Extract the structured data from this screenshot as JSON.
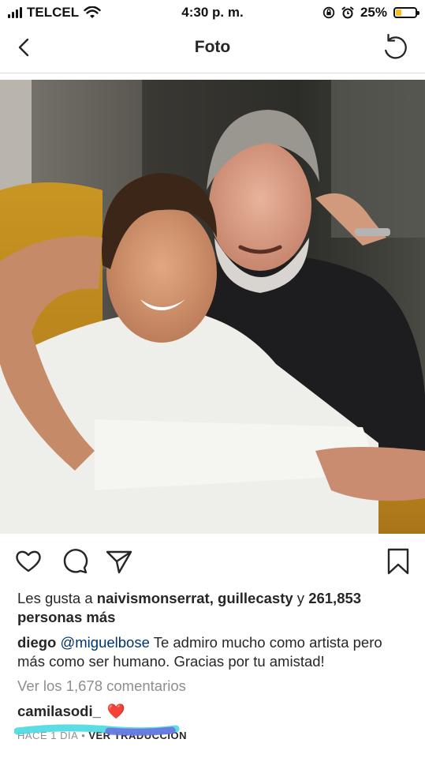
{
  "status_bar": {
    "carrier": "TELCEL",
    "time": "4:30 p. m.",
    "battery_percent": "25%",
    "battery_level": 0.25,
    "icons": [
      "signal-icon",
      "wifi-icon",
      "rotation-lock-icon",
      "alarm-icon",
      "battery-icon"
    ]
  },
  "nav": {
    "title": "Foto",
    "back_icon": "chevron-left-icon",
    "right_icon": "refresh-icon"
  },
  "post": {
    "actions": [
      "heart-icon",
      "comment-icon",
      "share-icon",
      "bookmark-icon"
    ],
    "likes": {
      "prefix": "Les gusta a ",
      "user1": "naivismonserrat",
      "comma": ", ",
      "user2": "guillecasty",
      "and": " y ",
      "count": "261,853",
      "suffix": "personas más"
    },
    "caption": {
      "author": "diego",
      "mention": "@miguelbose",
      "text": " Te admiro mucho como artista pero más como ser humano. Gracias por tu amistad!"
    },
    "view_comments": "Ver los 1,678 comentarios",
    "comment": {
      "user": "camilasodi_",
      "emoji": "❤️"
    },
    "meta": {
      "time_ago": "HACE 1 DÍA",
      "separator": "•",
      "translate": "VER TRADUCCIÓN"
    }
  },
  "colors": {
    "text": "#262626",
    "muted": "#8e8e8e",
    "mention": "#003569",
    "divider": "#dbdbdb",
    "battery": "#f4c21a"
  }
}
